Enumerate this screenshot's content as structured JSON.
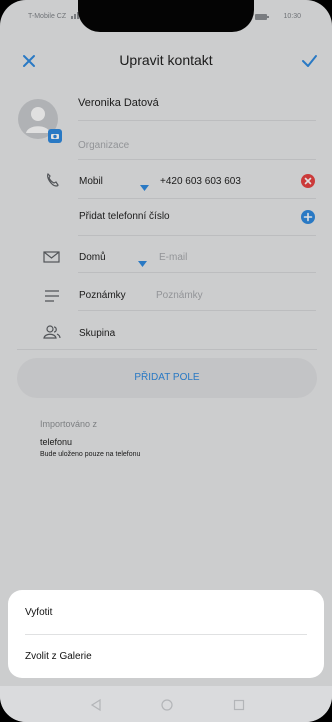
{
  "status_bar": {
    "carrier": "T-Mobile CZ",
    "time": "10:30"
  },
  "header": {
    "title": "Upravit kontakt"
  },
  "contact": {
    "name": "Veronika Datová",
    "organization_placeholder": "Organizace"
  },
  "phone": {
    "type": "Mobil",
    "number": "+420 603 603 603",
    "add_label": "Přidat telefonní číslo"
  },
  "email": {
    "type": "Domů",
    "placeholder": "E-mail"
  },
  "notes": {
    "label": "Poznámky",
    "placeholder": "Poznámky"
  },
  "group": {
    "label": "Skupina"
  },
  "add_field": {
    "label": "PŘIDAT POLE"
  },
  "import_info": {
    "label": "Importováno z",
    "source": "telefonu",
    "note": "Bude uloženo pouze na telefonu"
  },
  "photo_sheet": {
    "options": [
      "Vyfotit",
      "Zvolit z Galerie"
    ]
  },
  "colors": {
    "accent": "#2f8ae0",
    "remove": "#e84343",
    "background": "#e9eaeb"
  }
}
